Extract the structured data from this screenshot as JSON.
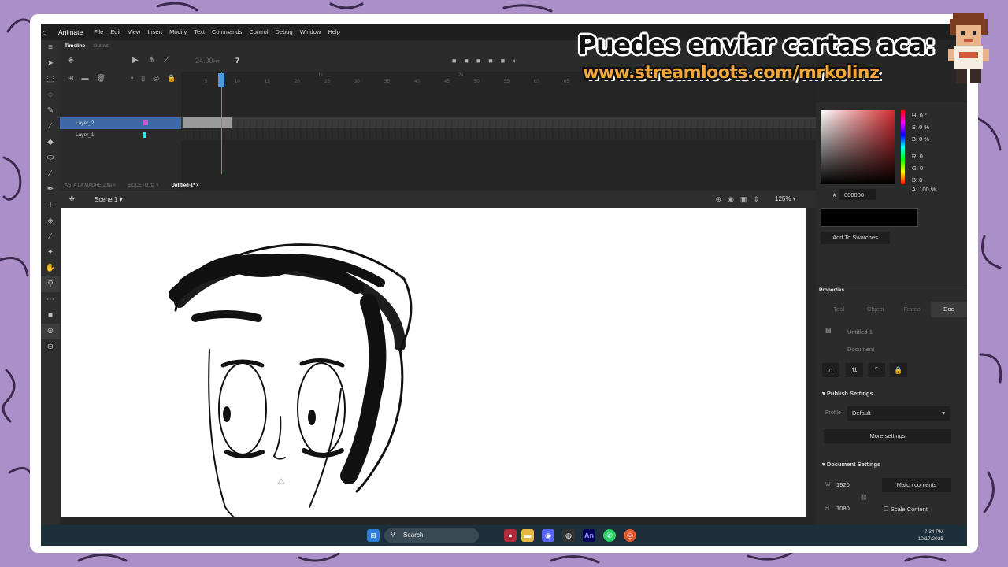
{
  "banner": {
    "line1": "Puedes enviar cartas aca:",
    "line2": "www.streamloots.com/mrkolinz"
  },
  "app": {
    "name": "Animate"
  },
  "menu": [
    "File",
    "Edit",
    "View",
    "Insert",
    "Modify",
    "Text",
    "Commands",
    "Control",
    "Debug",
    "Window",
    "Help"
  ],
  "timeline": {
    "tabs": [
      "Timeline",
      "Output"
    ],
    "fps": "24.00",
    "fps_unit": "FPS",
    "current_frame": "7",
    "ruler": [
      "5",
      "10",
      "15",
      "20",
      "25",
      "30",
      "35",
      "40",
      "45",
      "50",
      "55",
      "60",
      "65"
    ],
    "ruler_seconds": [
      "1s",
      "2s"
    ],
    "layers": [
      {
        "name": "Layer_2",
        "selected": true,
        "color": "#c85ad8"
      },
      {
        "name": "Layer_1",
        "selected": false,
        "color": "#3ee6e6"
      }
    ]
  },
  "doc_tabs": [
    {
      "label": "ASTA LA MADRE 2.fla",
      "active": false
    },
    {
      "label": "BOCETO.fla",
      "active": false
    },
    {
      "label": "Untitled-1*",
      "active": true
    }
  ],
  "scene": {
    "label": "Scene 1",
    "zoom": "125%"
  },
  "color": {
    "H": "H: 0 °",
    "S": "S: 0 %",
    "B": "B: 0 %",
    "R": "R: 0",
    "G": "G: 0",
    "Bl": "B: 0",
    "A": "A: 100 %",
    "hex": "000000",
    "add_swatches": "Add To Swatches"
  },
  "properties": {
    "title": "Properties",
    "tabs": [
      "Tool",
      "Object",
      "Frame",
      "Doc"
    ],
    "doc_name": "Untitled-1",
    "doc_type": "Document",
    "publish_settings": "Publish Settings",
    "profile_label": "Profile",
    "profile_value": "Default",
    "more_settings": "More settings",
    "document_settings": "Document Settings",
    "w_label": "W",
    "w_value": "1920",
    "h_label": "H",
    "h_value": "1080",
    "match_contents": "Match contents",
    "scale_content": "Scale Content"
  },
  "taskbar": {
    "search": "Search",
    "time": "7:34 PM",
    "date": "10/17/2025",
    "an_label": "An"
  }
}
